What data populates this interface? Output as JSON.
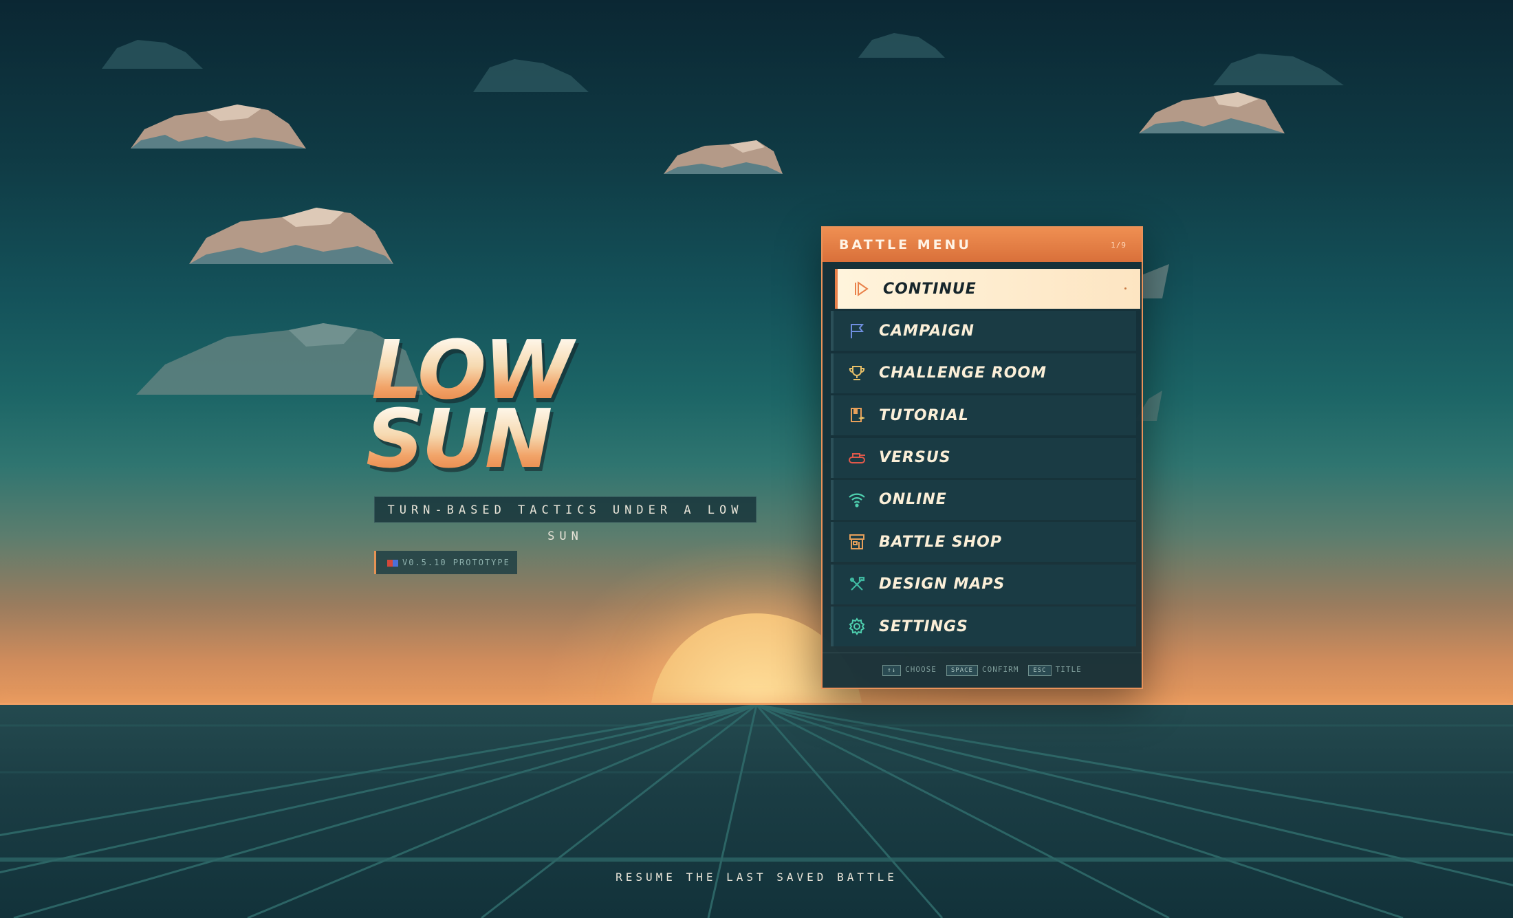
{
  "game": {
    "title_line1": "LOW",
    "title_line2": "SUN",
    "tagline": "TURN-BASED TACTICS UNDER A LOW SUN",
    "version": "V0.5.10 PROTOTYPE"
  },
  "menu": {
    "title": "BATTLE MENU",
    "position": "1/9",
    "selected_index": 0,
    "items": [
      {
        "label": "CONTINUE",
        "icon": "play-icon",
        "active": true
      },
      {
        "label": "CAMPAIGN",
        "icon": "flag-icon"
      },
      {
        "label": "CHALLENGE ROOM",
        "icon": "trophy-icon"
      },
      {
        "label": "TUTORIAL",
        "icon": "book-icon"
      },
      {
        "label": "VERSUS",
        "icon": "tank-icon"
      },
      {
        "label": "ONLINE",
        "icon": "wifi-icon"
      },
      {
        "label": "BATTLE SHOP",
        "icon": "shop-icon"
      },
      {
        "label": "DESIGN MAPS",
        "icon": "tools-icon"
      },
      {
        "label": "SETTINGS",
        "icon": "gear-icon"
      }
    ],
    "footer": {
      "choose_key": "↑↓",
      "choose_label": "CHOOSE",
      "confirm_key": "SPACE",
      "confirm_label": "CONFIRM",
      "back_key": "ESC",
      "back_label": "TITLE"
    }
  },
  "hint": "RESUME THE LAST SAVED BATTLE",
  "colors": {
    "accent": "#e9814a",
    "menu_bg": "#1a3b44",
    "active_bg": "#fff4dc",
    "text_light": "#fbefd8"
  }
}
